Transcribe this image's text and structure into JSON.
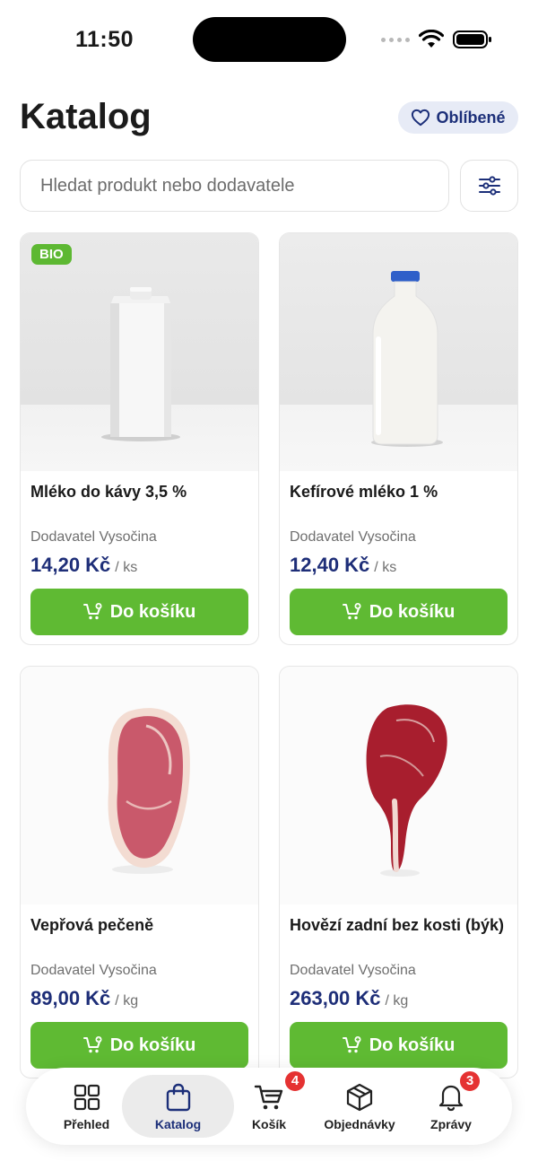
{
  "status_bar": {
    "time": "11:50"
  },
  "header": {
    "title": "Katalog",
    "favorites_label": "Oblíbené"
  },
  "search": {
    "placeholder": "Hledat produkt nebo dodavatele"
  },
  "products": [
    {
      "name": "Mléko do kávy 3,5 %",
      "supplier": "Dodavatel Vysočina",
      "price": "14,20 Kč",
      "unit": "/ ks",
      "badge": "BIO",
      "button": "Do košíku"
    },
    {
      "name": "Kefírové mléko 1 %",
      "supplier": "Dodavatel Vysočina",
      "price": "12,40 Kč",
      "unit": "/ ks",
      "button": "Do košíku"
    },
    {
      "name": "Vepřová pečeně",
      "supplier": "Dodavatel Vysočina",
      "price": "89,00 Kč",
      "unit": "/ kg",
      "button": "Do košíku"
    },
    {
      "name": "Hovězí zadní bez kosti (býk)",
      "supplier": "Dodavatel Vysočina",
      "price": "263,00 Kč",
      "unit": "/ kg",
      "button": "Do košíku"
    }
  ],
  "nav": {
    "items": [
      {
        "label": "Přehled",
        "icon": "grid-icon"
      },
      {
        "label": "Katalog",
        "icon": "bag-icon",
        "active": true
      },
      {
        "label": "Košík",
        "icon": "cart-icon",
        "badge": "4"
      },
      {
        "label": "Objednávky",
        "icon": "box-icon"
      },
      {
        "label": "Zprávy",
        "icon": "bell-icon",
        "badge": "3"
      }
    ]
  },
  "colors": {
    "brand_blue": "#1e2e78",
    "cta_green": "#5fba33",
    "badge_red": "#e53232"
  }
}
